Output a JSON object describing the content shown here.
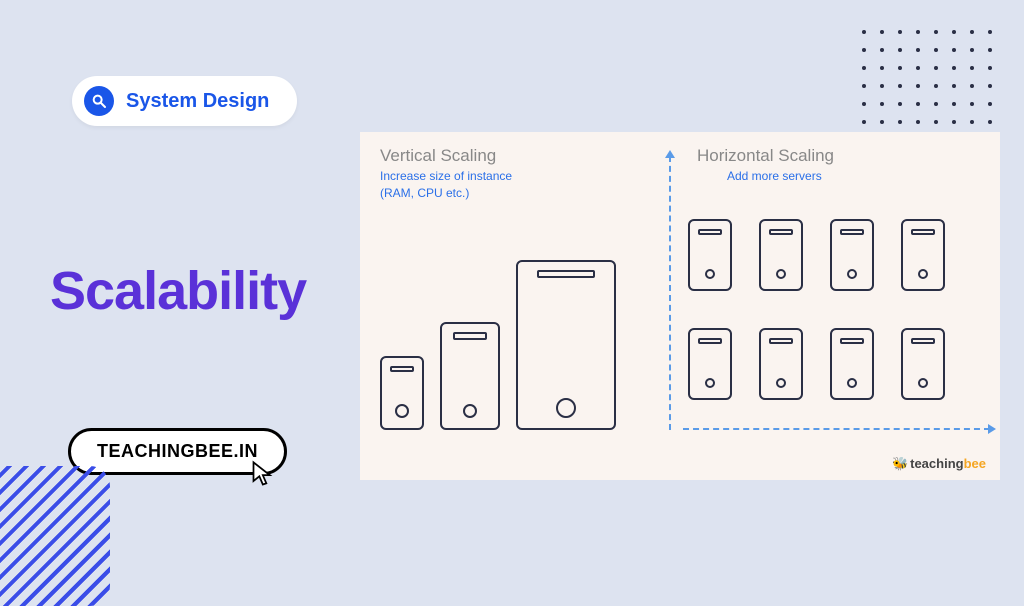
{
  "tag_label": "System Design",
  "title": "Scalability",
  "site_badge": "TEACHINGBEE.IN",
  "watermark_prefix": "teaching",
  "watermark_suffix": "bee",
  "diagram": {
    "vertical": {
      "heading": "Vertical Scaling",
      "sub_line1": "Increase size of instance",
      "sub_line2": "(RAM, CPU etc.)"
    },
    "horizontal": {
      "heading": "Horizontal Scaling",
      "sub": "Add more servers"
    }
  }
}
